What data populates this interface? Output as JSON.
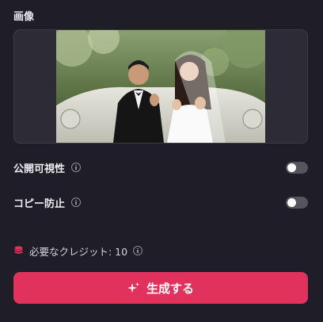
{
  "image_section": {
    "title": "画像"
  },
  "settings": {
    "public_visibility": {
      "label": "公開可視性",
      "enabled": false
    },
    "copy_protection": {
      "label": "コピー防止",
      "enabled": false
    }
  },
  "credits": {
    "label": "必要なクレジット: 10"
  },
  "generate_button": {
    "label": "生成する"
  },
  "colors": {
    "background": "#1f1e28",
    "accent": "#e0325d",
    "toggle_off": "#56555f"
  },
  "icons": {
    "info": "info-icon",
    "coin": "coin-stack-icon",
    "sparkle": "sparkle-icon"
  }
}
